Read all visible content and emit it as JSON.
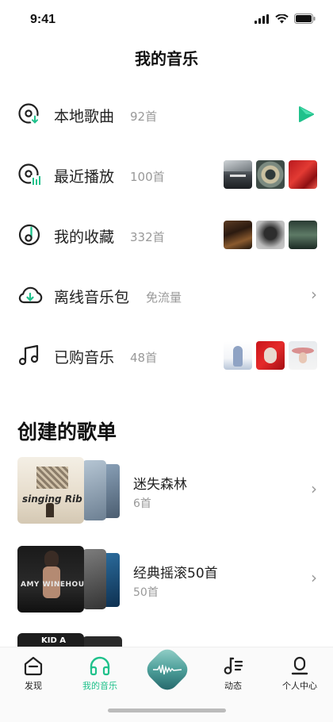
{
  "status": {
    "time": "9:41"
  },
  "header": {
    "title": "我的音乐"
  },
  "menu": [
    {
      "label": "本地歌曲",
      "count": "92首",
      "icon": "local-music-icon"
    },
    {
      "label": "最近播放",
      "count": "100首",
      "icon": "recent-play-icon"
    },
    {
      "label": "我的收藏",
      "count": "332首",
      "icon": "favorites-icon"
    },
    {
      "label": "离线音乐包",
      "count": "免流量",
      "icon": "offline-cloud-icon"
    },
    {
      "label": "已购音乐",
      "count": "48首",
      "icon": "purchased-music-icon"
    }
  ],
  "section": {
    "title": "创建的歌单"
  },
  "playlists": [
    {
      "name": "迷失森林",
      "count": "6首",
      "cover_text": "singing Rib"
    },
    {
      "name": "经典摇滚50首",
      "count": "50首",
      "cover_text": "AMY WINEHOUSE"
    },
    {
      "name": "",
      "count": "",
      "cover_text": "KID A"
    }
  ],
  "nav": [
    {
      "label": "发现",
      "icon": "discover-home-icon",
      "active": false
    },
    {
      "label": "我的音乐",
      "icon": "headphones-icon",
      "active": true
    },
    {
      "label": "",
      "icon": "now-playing-disc-icon",
      "active": false
    },
    {
      "label": "动态",
      "icon": "feed-music-note-icon",
      "active": false
    },
    {
      "label": "个人中心",
      "icon": "profile-icon",
      "active": false
    }
  ],
  "colors": {
    "accent": "#1fc18b",
    "text": "#222222",
    "muted": "#999999"
  }
}
